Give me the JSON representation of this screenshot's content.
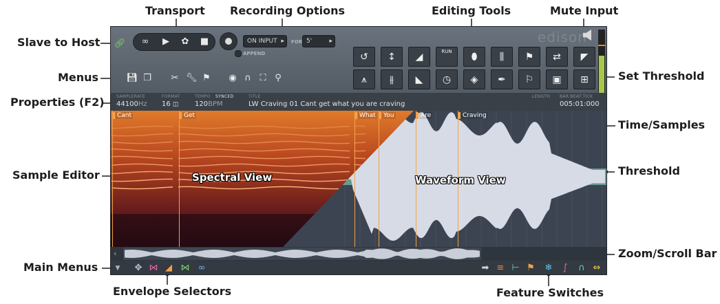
{
  "callouts": {
    "transport": "Transport",
    "recording_options": "Recording Options",
    "editing_tools": "Editing Tools",
    "mute_input": "Mute Input",
    "slave_to_host": "Slave to Host",
    "menus": "Menus",
    "set_threshold": "Set Threshold",
    "properties": "Properties (F2)",
    "time_samples": "Time/Samples",
    "sample_editor": "Sample Editor",
    "threshold": "Threshold",
    "zoom_scroll": "Zoom/Scroll Bar",
    "main_menus": "Main Menus",
    "envelope_selectors": "Envelope Selectors",
    "feature_switches": "Feature Switches"
  },
  "header": {
    "logo": "edison",
    "record_mode": "ON INPUT",
    "for_label": "FOR",
    "for_value": "5'",
    "append_label": "APPEND",
    "tool_run_label": "RUN"
  },
  "icons": {
    "transport": [
      "loop-icon",
      "play-icon",
      "fan-icon",
      "stop-icon"
    ],
    "record": "record-icon",
    "menus": [
      "save-icon",
      "copy-icon",
      "scissors-icon",
      "wrench-icon",
      "flag-icon",
      "eye-icon",
      "magnet-icon",
      "zoom-fit-icon",
      "zoom-icon"
    ],
    "tools_row1": [
      "reverse-icon",
      "normalize-icon",
      "fade-in-icon",
      "run-icon",
      "declick-icon",
      "equalize-icon",
      "add-marker-icon",
      "loop-icon",
      "trim-icon"
    ],
    "tools_row2": [
      "split-icon",
      "noise-icon",
      "fade-out-icon",
      "time-stretch-icon",
      "drop-icon",
      "pen-icon",
      "marker-tool-icon",
      "save-region-icon",
      "insert-silence-icon"
    ],
    "envelopes": [
      "pan-envelope-icon",
      "volume-envelope-icon",
      "fade-envelope-icon",
      "stretch-envelope-icon",
      "link-icon"
    ],
    "features": [
      "arrow-right-icon",
      "comb-icon",
      "grid-icon",
      "flag-icon",
      "snowflake-icon",
      "curve-icon",
      "magnet-icon",
      "swap-icon"
    ]
  },
  "properties": {
    "samplerate_label": "SAMPLERATE",
    "samplerate_value": "44100",
    "samplerate_unit": "Hz",
    "format_label": "FORMAT",
    "format_value": "16",
    "tempo_label": "TEMPO",
    "synced_label": "SYNCED",
    "tempo_value": "120",
    "tempo_unit": "BPM",
    "title_label": "TITLE",
    "title_value": "LW Craving 01 Cant get what you are craving",
    "length_label": "LENGTH",
    "position_label": "BAR:BEAT:TICK",
    "position_value": "005:01:000"
  },
  "editor": {
    "markers": [
      "Cant",
      "Get",
      "What",
      "You",
      "Are",
      "Craving"
    ],
    "spectral_label": "Spectral View",
    "waveform_label": "Waveform View"
  },
  "colors": {
    "panel": "#3f454d",
    "marker": "#f2a24a",
    "threshold": "#8be3c2",
    "waveform": "#d7dbe6",
    "meter": "#a6c94a"
  }
}
